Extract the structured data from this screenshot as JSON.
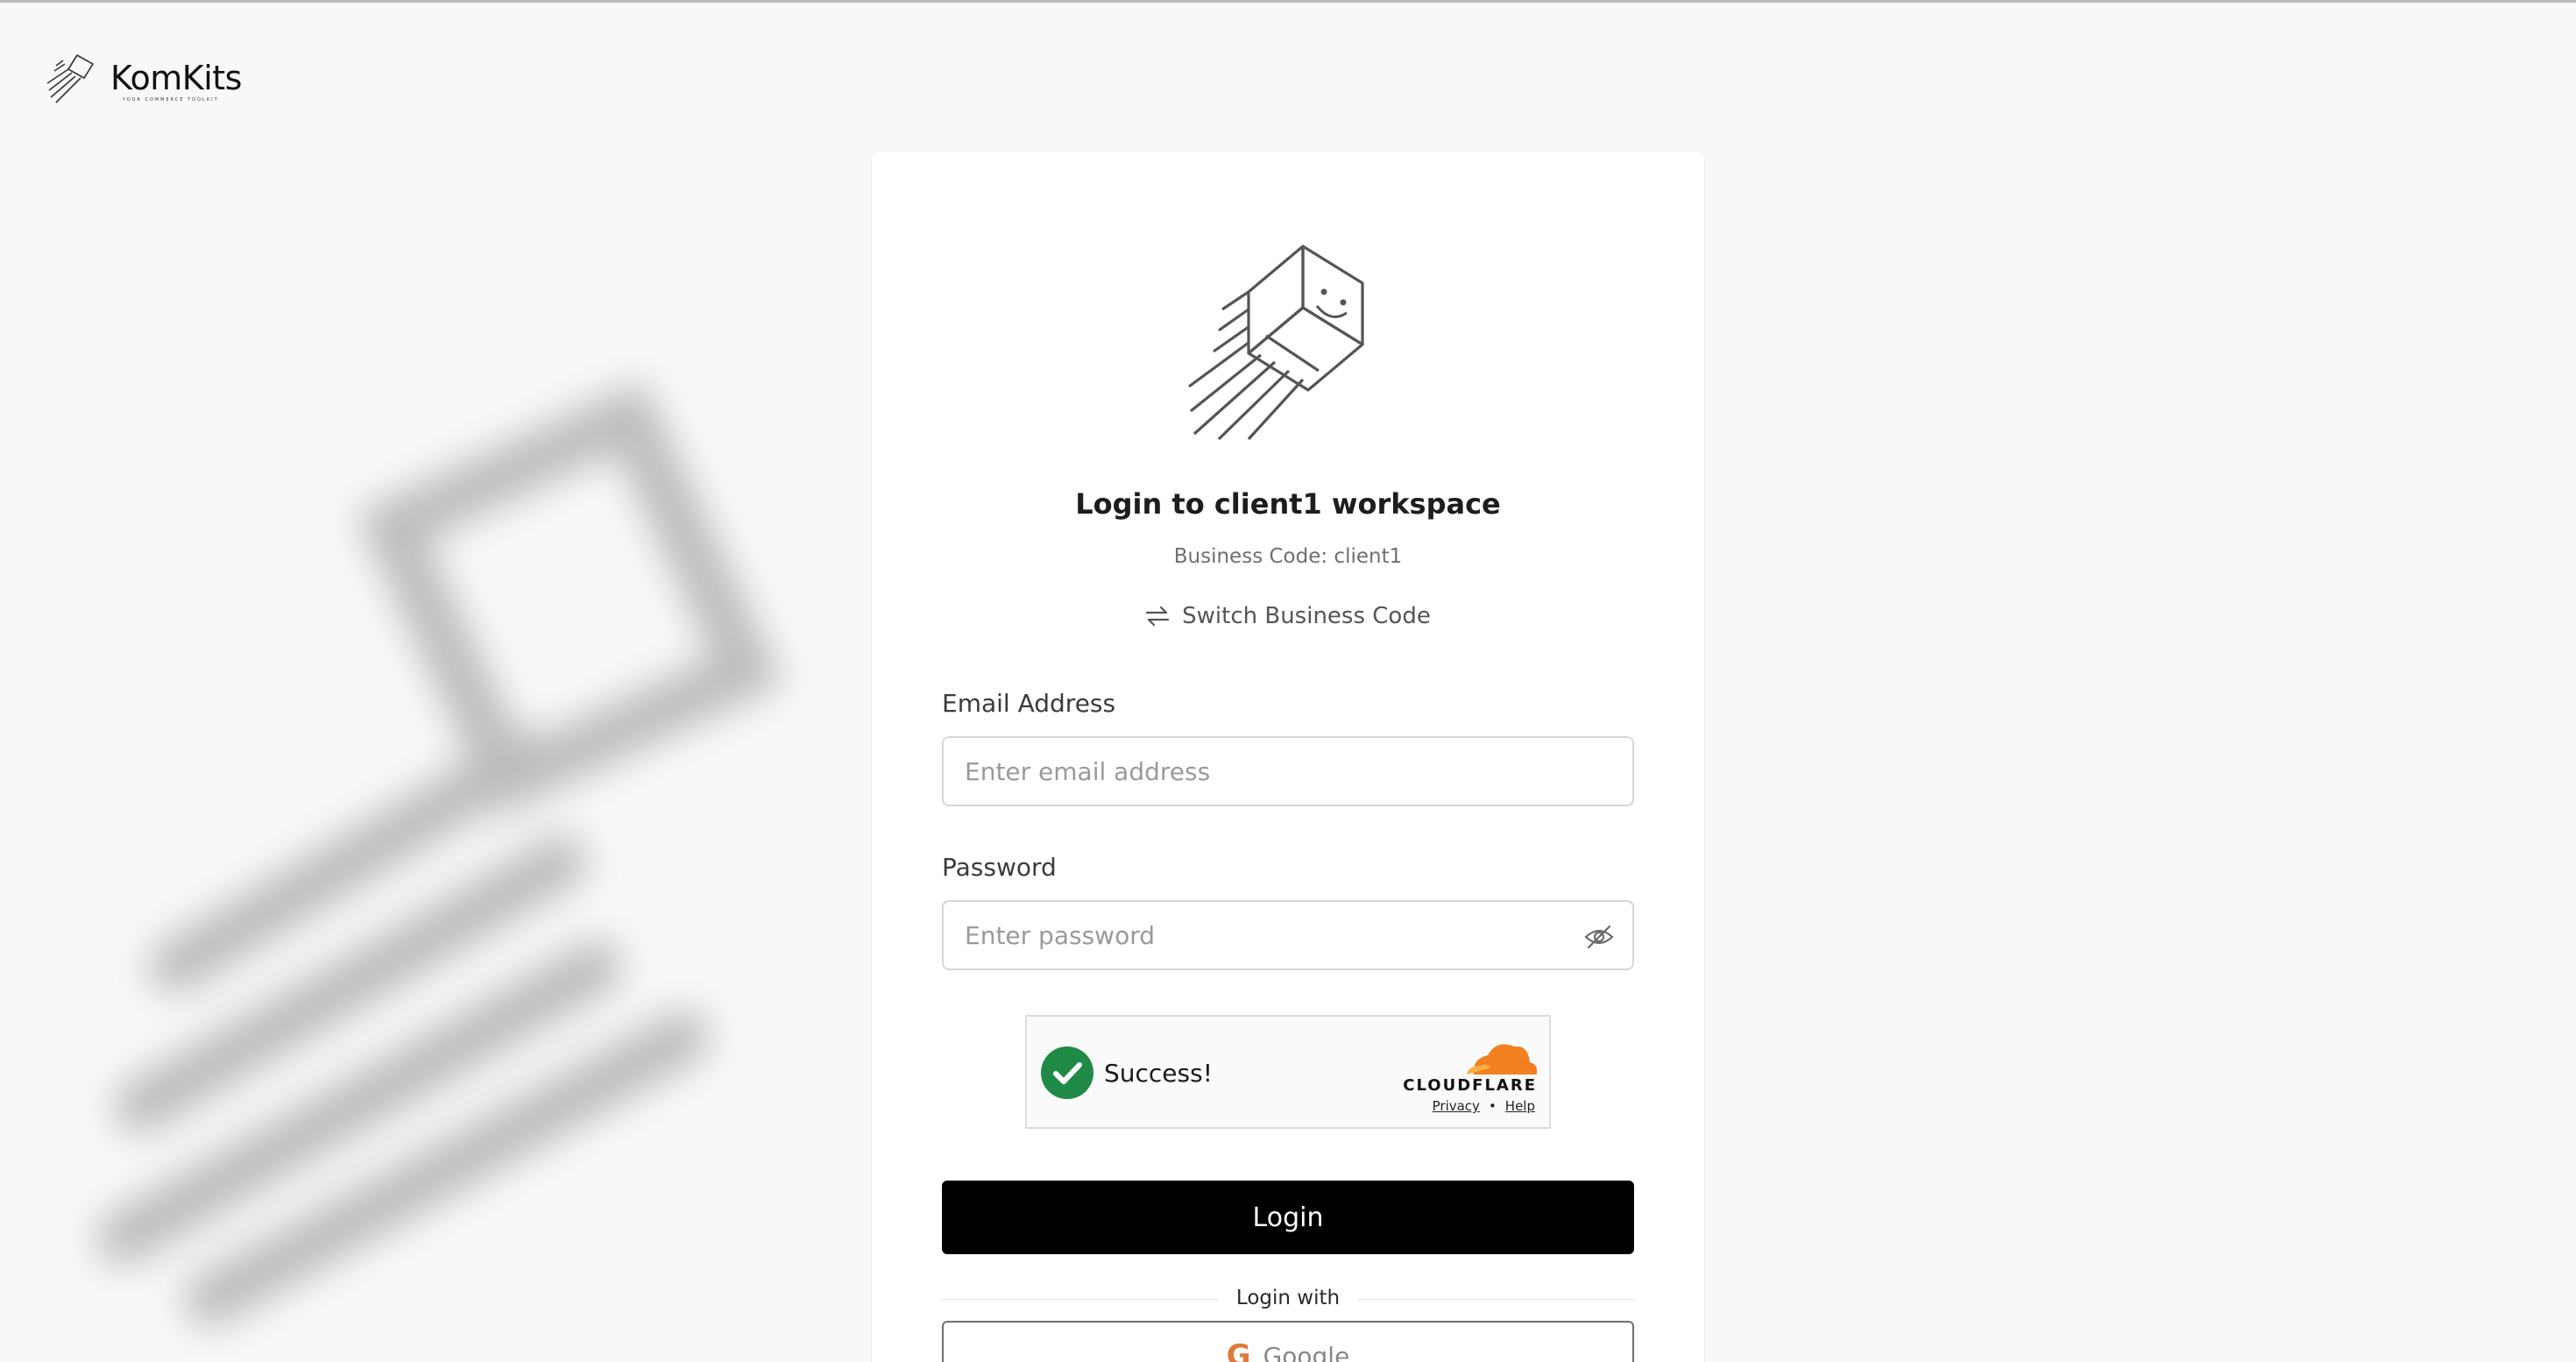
{
  "brand": {
    "name": "KomKits",
    "tagline": "YOUR COMMERCE TOOLKIT"
  },
  "login": {
    "title": "Login to client1 workspace",
    "business_code_text": "Business Code: client1",
    "switch_label": "Switch Business Code",
    "email": {
      "label": "Email Address",
      "placeholder": "Enter email address",
      "value": ""
    },
    "password": {
      "label": "Password",
      "placeholder": "Enter password",
      "value": ""
    },
    "captcha": {
      "status": "Success!",
      "provider": "CLOUDFLARE",
      "privacy_link": "Privacy",
      "separator": "•",
      "help_link": "Help"
    },
    "submit_label": "Login",
    "alt_login_label": "Login with",
    "google_label": "Google"
  },
  "colors": {
    "primary_button": "#000000",
    "captcha_success": "#1f8a45",
    "cloudflare_orange": "#f38020"
  }
}
